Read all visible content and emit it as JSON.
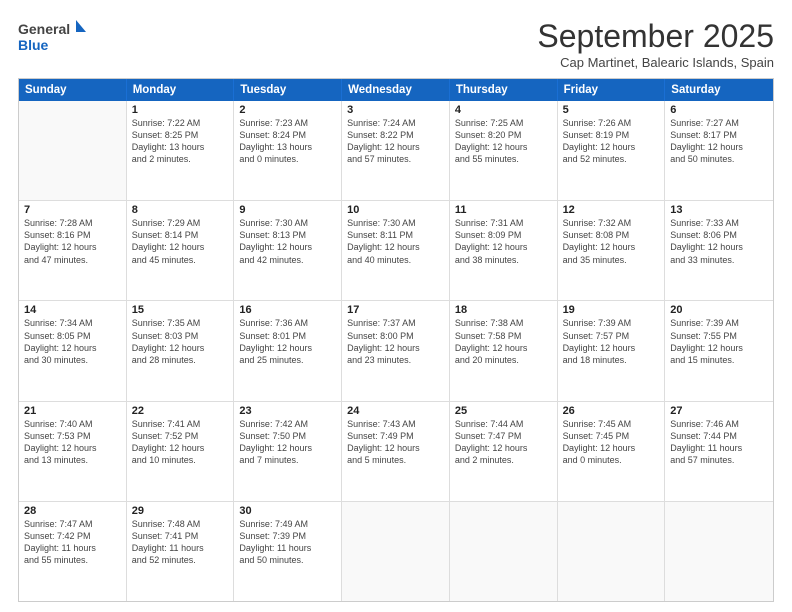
{
  "logo": {
    "general": "General",
    "blue": "Blue"
  },
  "header": {
    "month": "September 2025",
    "subtitle": "Cap Martinet, Balearic Islands, Spain"
  },
  "days": [
    "Sunday",
    "Monday",
    "Tuesday",
    "Wednesday",
    "Thursday",
    "Friday",
    "Saturday"
  ],
  "weeks": [
    [
      {
        "day": "",
        "info": ""
      },
      {
        "day": "1",
        "info": "Sunrise: 7:22 AM\nSunset: 8:25 PM\nDaylight: 13 hours\nand 2 minutes."
      },
      {
        "day": "2",
        "info": "Sunrise: 7:23 AM\nSunset: 8:24 PM\nDaylight: 13 hours\nand 0 minutes."
      },
      {
        "day": "3",
        "info": "Sunrise: 7:24 AM\nSunset: 8:22 PM\nDaylight: 12 hours\nand 57 minutes."
      },
      {
        "day": "4",
        "info": "Sunrise: 7:25 AM\nSunset: 8:20 PM\nDaylight: 12 hours\nand 55 minutes."
      },
      {
        "day": "5",
        "info": "Sunrise: 7:26 AM\nSunset: 8:19 PM\nDaylight: 12 hours\nand 52 minutes."
      },
      {
        "day": "6",
        "info": "Sunrise: 7:27 AM\nSunset: 8:17 PM\nDaylight: 12 hours\nand 50 minutes."
      }
    ],
    [
      {
        "day": "7",
        "info": "Sunrise: 7:28 AM\nSunset: 8:16 PM\nDaylight: 12 hours\nand 47 minutes."
      },
      {
        "day": "8",
        "info": "Sunrise: 7:29 AM\nSunset: 8:14 PM\nDaylight: 12 hours\nand 45 minutes."
      },
      {
        "day": "9",
        "info": "Sunrise: 7:30 AM\nSunset: 8:13 PM\nDaylight: 12 hours\nand 42 minutes."
      },
      {
        "day": "10",
        "info": "Sunrise: 7:30 AM\nSunset: 8:11 PM\nDaylight: 12 hours\nand 40 minutes."
      },
      {
        "day": "11",
        "info": "Sunrise: 7:31 AM\nSunset: 8:09 PM\nDaylight: 12 hours\nand 38 minutes."
      },
      {
        "day": "12",
        "info": "Sunrise: 7:32 AM\nSunset: 8:08 PM\nDaylight: 12 hours\nand 35 minutes."
      },
      {
        "day": "13",
        "info": "Sunrise: 7:33 AM\nSunset: 8:06 PM\nDaylight: 12 hours\nand 33 minutes."
      }
    ],
    [
      {
        "day": "14",
        "info": "Sunrise: 7:34 AM\nSunset: 8:05 PM\nDaylight: 12 hours\nand 30 minutes."
      },
      {
        "day": "15",
        "info": "Sunrise: 7:35 AM\nSunset: 8:03 PM\nDaylight: 12 hours\nand 28 minutes."
      },
      {
        "day": "16",
        "info": "Sunrise: 7:36 AM\nSunset: 8:01 PM\nDaylight: 12 hours\nand 25 minutes."
      },
      {
        "day": "17",
        "info": "Sunrise: 7:37 AM\nSunset: 8:00 PM\nDaylight: 12 hours\nand 23 minutes."
      },
      {
        "day": "18",
        "info": "Sunrise: 7:38 AM\nSunset: 7:58 PM\nDaylight: 12 hours\nand 20 minutes."
      },
      {
        "day": "19",
        "info": "Sunrise: 7:39 AM\nSunset: 7:57 PM\nDaylight: 12 hours\nand 18 minutes."
      },
      {
        "day": "20",
        "info": "Sunrise: 7:39 AM\nSunset: 7:55 PM\nDaylight: 12 hours\nand 15 minutes."
      }
    ],
    [
      {
        "day": "21",
        "info": "Sunrise: 7:40 AM\nSunset: 7:53 PM\nDaylight: 12 hours\nand 13 minutes."
      },
      {
        "day": "22",
        "info": "Sunrise: 7:41 AM\nSunset: 7:52 PM\nDaylight: 12 hours\nand 10 minutes."
      },
      {
        "day": "23",
        "info": "Sunrise: 7:42 AM\nSunset: 7:50 PM\nDaylight: 12 hours\nand 7 minutes."
      },
      {
        "day": "24",
        "info": "Sunrise: 7:43 AM\nSunset: 7:49 PM\nDaylight: 12 hours\nand 5 minutes."
      },
      {
        "day": "25",
        "info": "Sunrise: 7:44 AM\nSunset: 7:47 PM\nDaylight: 12 hours\nand 2 minutes."
      },
      {
        "day": "26",
        "info": "Sunrise: 7:45 AM\nSunset: 7:45 PM\nDaylight: 12 hours\nand 0 minutes."
      },
      {
        "day": "27",
        "info": "Sunrise: 7:46 AM\nSunset: 7:44 PM\nDaylight: 11 hours\nand 57 minutes."
      }
    ],
    [
      {
        "day": "28",
        "info": "Sunrise: 7:47 AM\nSunset: 7:42 PM\nDaylight: 11 hours\nand 55 minutes."
      },
      {
        "day": "29",
        "info": "Sunrise: 7:48 AM\nSunset: 7:41 PM\nDaylight: 11 hours\nand 52 minutes."
      },
      {
        "day": "30",
        "info": "Sunrise: 7:49 AM\nSunset: 7:39 PM\nDaylight: 11 hours\nand 50 minutes."
      },
      {
        "day": "",
        "info": ""
      },
      {
        "day": "",
        "info": ""
      },
      {
        "day": "",
        "info": ""
      },
      {
        "day": "",
        "info": ""
      }
    ]
  ]
}
